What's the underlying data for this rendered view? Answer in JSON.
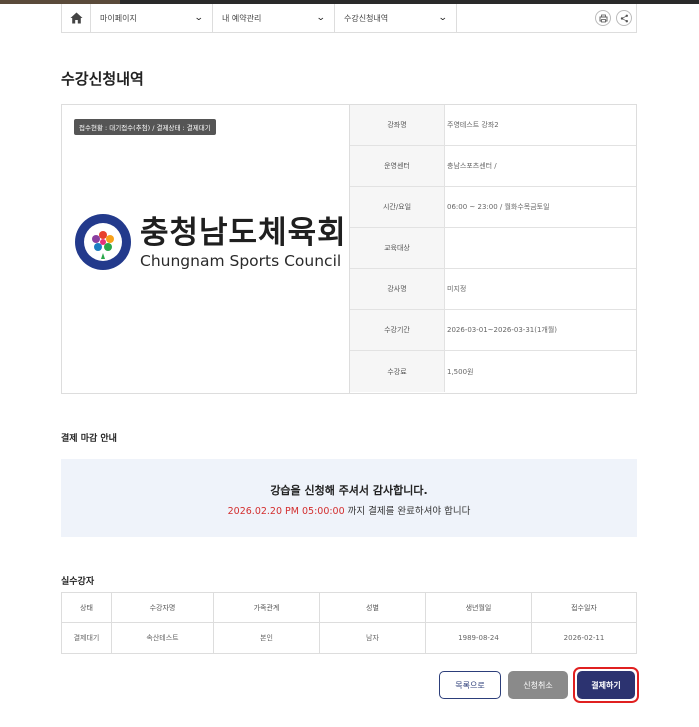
{
  "nav": {
    "dropdowns": [
      "마이페이지",
      "내 예약관리",
      "수강신청내역"
    ]
  },
  "page": {
    "title": "수강신청내역"
  },
  "status_tag": "접수현황 : 대기접수(추첨) / 결제상태 : 결제대기",
  "logo": {
    "ko": "충청남도체육회",
    "en": "Chungnam Sports Council",
    "ring_text": "Chungnam Sports Council · 충청남도체육회"
  },
  "details": [
    {
      "label": "강좌명",
      "value": "주영테스트 강좌2"
    },
    {
      "label": "운영센터",
      "value": "충남스포츠센터 /"
    },
    {
      "label": "시간/요일",
      "value": "06:00 ~ 23:00 / 월화수목금토일"
    },
    {
      "label": "교육대상",
      "value": ""
    },
    {
      "label": "강사명",
      "value": "미지정"
    },
    {
      "label": "수강기간",
      "value": "2026-03-01~2026-03-31(1개월)"
    },
    {
      "label": "수강료",
      "value": "1,500원"
    }
  ],
  "payment_section": {
    "heading": "결제 마감 안내",
    "thanks": "강습을 신청해 주셔서 감사합니다.",
    "deadline": "2026.02.20 PM 05:00:00",
    "deadline_suffix": " 까지 결제를 완료하셔야 합니다"
  },
  "students": {
    "heading": "실수강자",
    "columns": [
      "상태",
      "수강자명",
      "가족관계",
      "성별",
      "생년월일",
      "접수일자"
    ],
    "rows": [
      [
        "결제대기",
        "속산테스트",
        "본인",
        "남자",
        "1989-08-24",
        "2026-02-11"
      ]
    ]
  },
  "buttons": {
    "list": "목록으로",
    "cancel": "신청취소",
    "pay": "결제하기"
  },
  "colors": {
    "accent": "#2c3370",
    "deadline": "#d32f2f",
    "highlight": "#e02020"
  }
}
